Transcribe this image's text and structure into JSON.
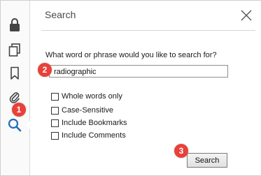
{
  "panel": {
    "title": "Search",
    "prompt": "What word or phrase would you like to search for?",
    "search_value": "radiographic",
    "options": [
      {
        "label": "Whole words only",
        "checked": false
      },
      {
        "label": "Case-Sensitive",
        "checked": false
      },
      {
        "label": "Include Bookmarks",
        "checked": false
      },
      {
        "label": "Include Comments",
        "checked": false
      }
    ],
    "search_button_label": "Search"
  },
  "rail": {
    "icons": [
      "lock-icon",
      "pages-icon",
      "bookmark-icon",
      "attachment-icon",
      "search-icon"
    ],
    "active": "search-icon",
    "accent_color": "#1f6fb5"
  },
  "annotations": {
    "color": "#e8413a",
    "markers": [
      "1",
      "2",
      "3"
    ]
  }
}
